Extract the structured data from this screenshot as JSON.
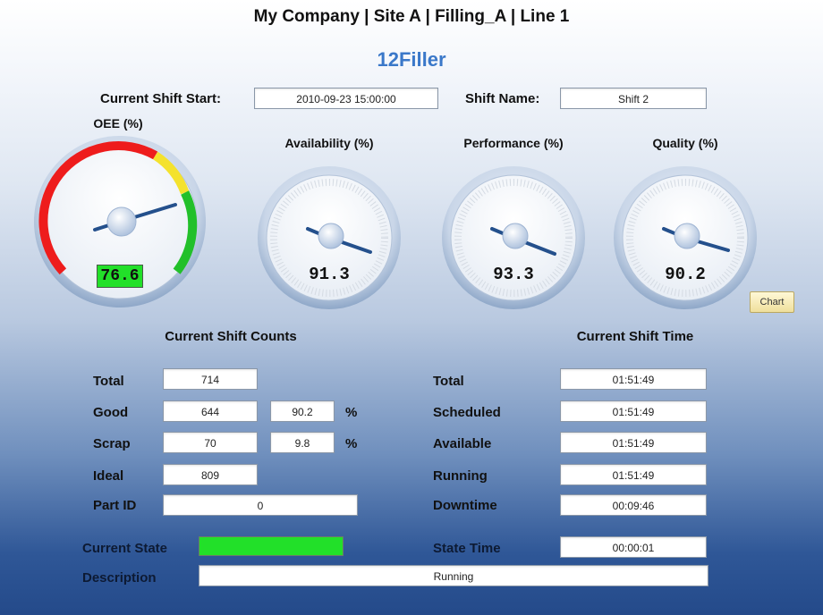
{
  "header": {
    "title": "My Company | Site A | Filling_A | Line 1",
    "app_name": "12Filler"
  },
  "shift": {
    "start_label": "Current Shift Start:",
    "start_value": "2010-09-23 15:00:00",
    "name_label": "Shift Name:",
    "name_value": "Shift 2"
  },
  "gauges": {
    "oee": {
      "title": "OEE (%)",
      "value": "76.6",
      "display_color": "#22e029"
    },
    "availability": {
      "title": "Availability (%)",
      "value": "91.3"
    },
    "performance": {
      "title": "Performance (%)",
      "value": "93.3"
    },
    "quality": {
      "title": "Quality (%)",
      "value": "90.2"
    }
  },
  "chart_button_label": "Chart",
  "counts": {
    "title": "Current Shift Counts",
    "total_label": "Total",
    "total_value": "714",
    "good_label": "Good",
    "good_value": "644",
    "good_pct": "90.2",
    "good_pct_unit": "%",
    "scrap_label": "Scrap",
    "scrap_value": "70",
    "scrap_pct": "9.8",
    "scrap_pct_unit": "%",
    "ideal_label": "Ideal",
    "ideal_value": "809",
    "part_label": "Part ID",
    "part_value": "0"
  },
  "time": {
    "title": "Current Shift Time",
    "total_label": "Total",
    "total_value": "01:51:49",
    "scheduled_label": "Scheduled",
    "scheduled_value": "01:51:49",
    "available_label": "Available",
    "available_value": "01:51:49",
    "running_label": "Running",
    "running_value": "01:51:49",
    "downtime_label": "Downtime",
    "downtime_value": "00:09:46"
  },
  "state": {
    "current_label": "Current State",
    "color": "#22e029",
    "time_label": "State Time",
    "time_value": "00:00:01",
    "description_label": "Description",
    "description_value": "Running"
  }
}
